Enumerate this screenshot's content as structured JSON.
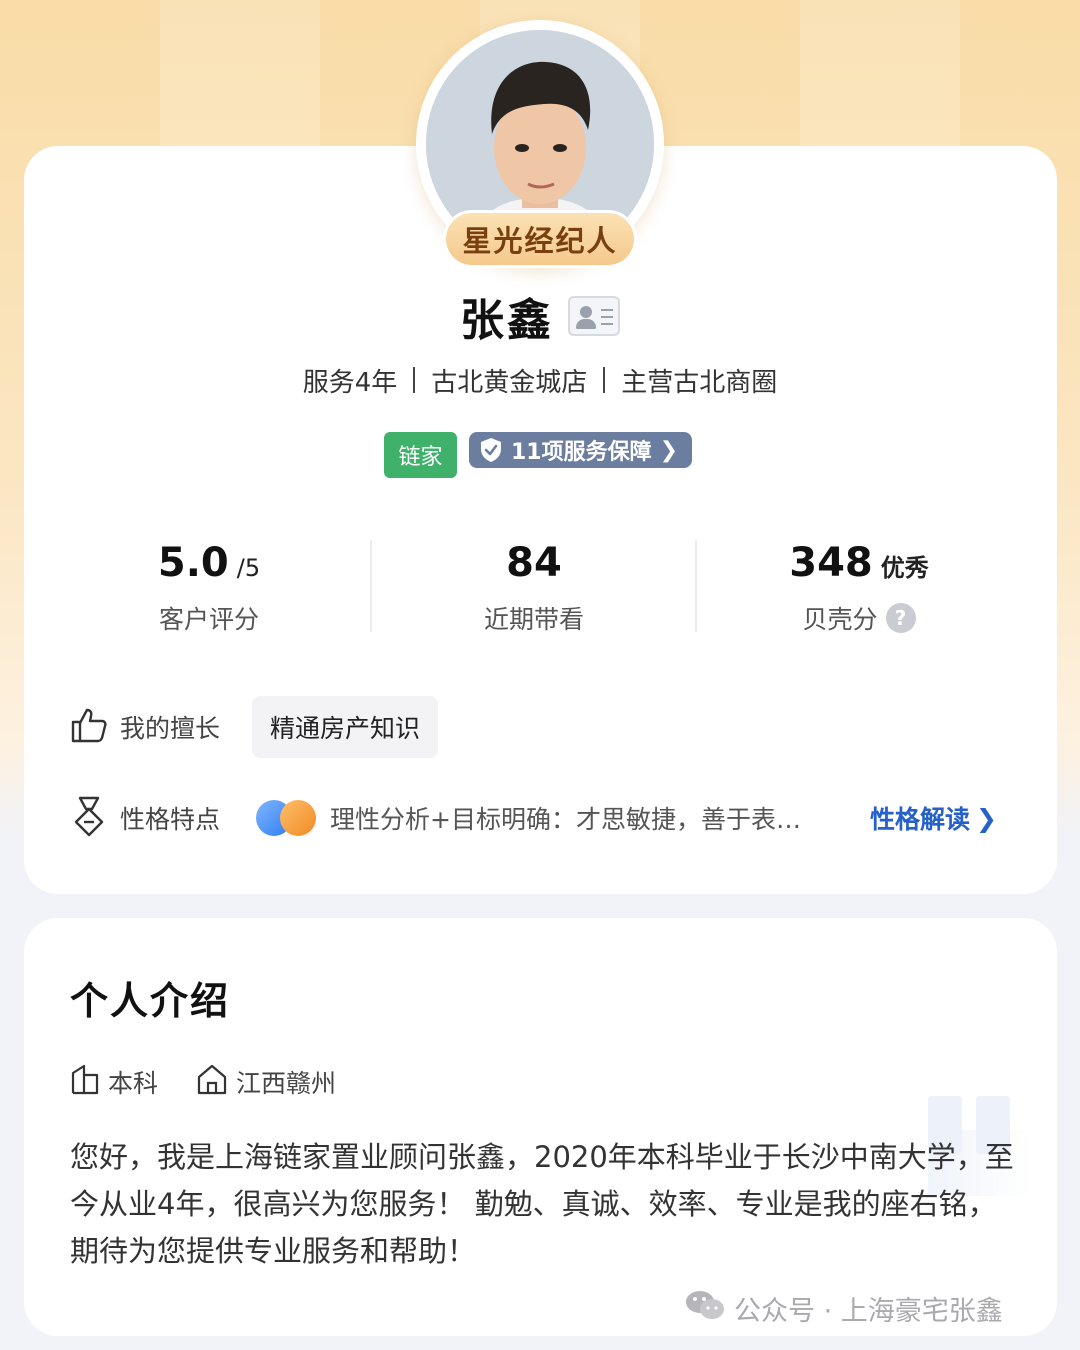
{
  "profile": {
    "badge": "星光经纪人",
    "name": "张鑫",
    "meta": [
      "服务4年",
      "古北黄金城店",
      "主营古北商圈"
    ],
    "brand_tag": "链家",
    "service_tag": "11项服务保障"
  },
  "stats": [
    {
      "value": "5.0",
      "suffix": "/5",
      "label": "客户评分"
    },
    {
      "value": "84",
      "suffix": "",
      "label": "近期带看"
    },
    {
      "value": "348",
      "suffix": "优秀",
      "label": "贝壳分"
    }
  ],
  "strength": {
    "label": "我的擅长",
    "chip": "精通房产知识"
  },
  "trait": {
    "label": "性格特点",
    "text": "理性分析+目标明确：才思敏捷，善于表…",
    "link": "性格解读"
  },
  "intro": {
    "title": "个人介绍",
    "education": "本科",
    "hometown": "江西赣州",
    "text": "您好，我是上海链家置业顾问张鑫，2020年本科毕业于长沙中南大学，至今从业4年，很高兴为您服务！ 勤勉、真诚、效率、专业是我的座右铭，期待为您提供专业服务和帮助！"
  },
  "watermark": "公众号 · 上海豪宅张鑫",
  "colors": {
    "brand_green": "#3fb16b",
    "service_tag": "#6c7ea0",
    "link_blue": "#2660c9",
    "badge_text": "#7a3f10"
  }
}
